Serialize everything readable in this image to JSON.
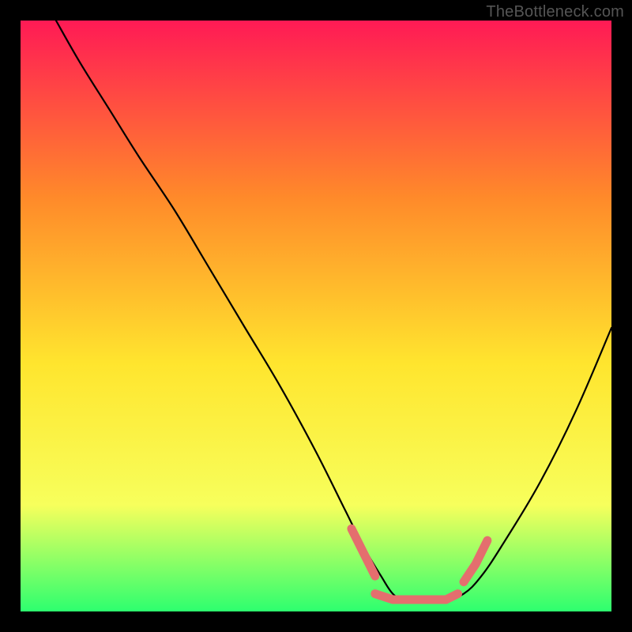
{
  "watermark": "TheBottleneck.com",
  "colors": {
    "frame": "#000000",
    "gradient_top": "#ff1a55",
    "gradient_mid1": "#ff8a2a",
    "gradient_mid2": "#ffe52e",
    "gradient_mid3": "#f7ff5c",
    "gradient_bottom": "#2dff6f",
    "curve": "#000000",
    "salmon": "#e46e6e"
  },
  "chart_data": {
    "type": "line",
    "title": "",
    "xlabel": "",
    "ylabel": "",
    "xlim": [
      0,
      100
    ],
    "ylim": [
      0,
      100
    ],
    "series": [
      {
        "name": "bottleneck-curve",
        "x": [
          6,
          10,
          15,
          20,
          26,
          32,
          38,
          44,
          50,
          55,
          58,
          61,
          63,
          65,
          69,
          72,
          75,
          78,
          82,
          88,
          94,
          100
        ],
        "y": [
          100,
          93,
          85,
          77,
          68,
          58,
          48,
          38,
          27,
          17,
          11,
          6,
          3,
          2,
          2,
          2,
          3,
          6,
          12,
          22,
          34,
          48
        ]
      },
      {
        "name": "highlight-left",
        "x": [
          56,
          58,
          60
        ],
        "y": [
          14,
          10,
          6
        ]
      },
      {
        "name": "highlight-bottom",
        "x": [
          60,
          63,
          66,
          69,
          72,
          74
        ],
        "y": [
          3,
          2,
          2,
          2,
          2,
          3
        ]
      },
      {
        "name": "highlight-right",
        "x": [
          75,
          77,
          79
        ],
        "y": [
          5,
          8,
          12
        ]
      }
    ]
  }
}
